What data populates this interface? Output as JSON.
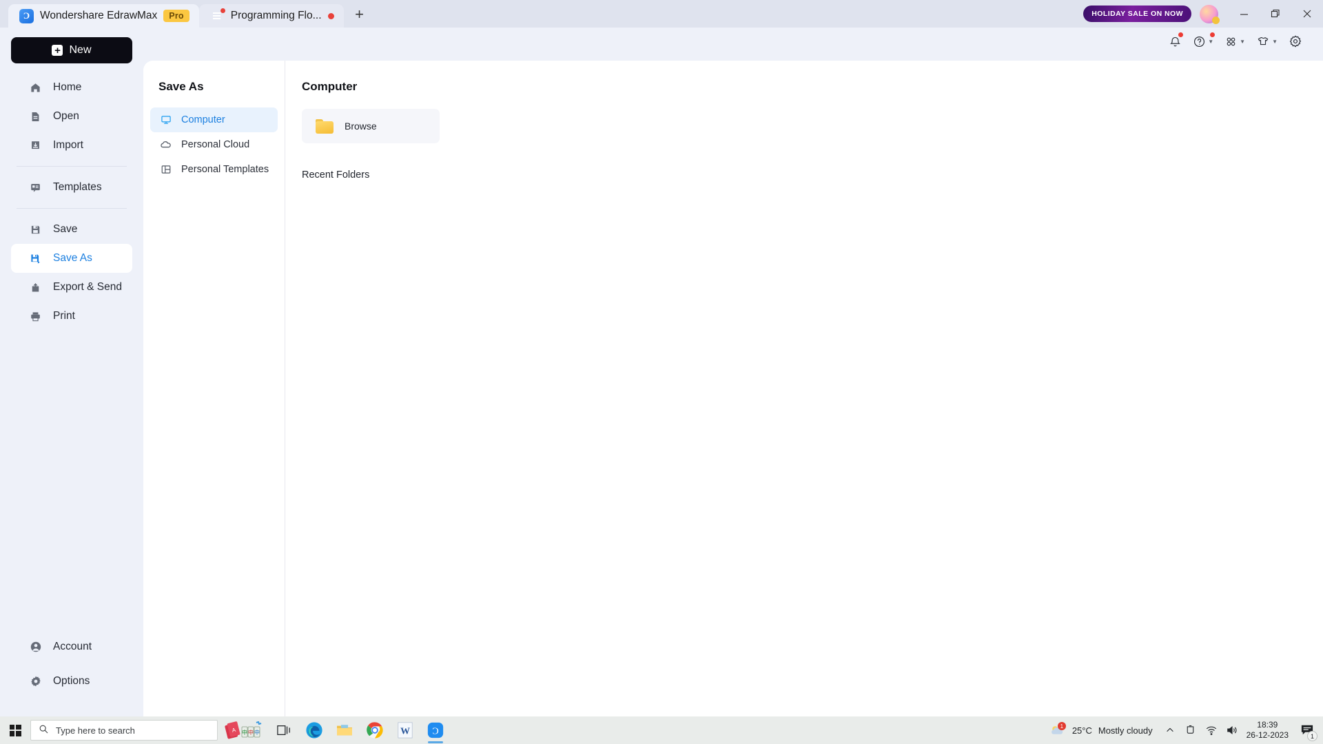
{
  "window": {
    "tabs": [
      {
        "title": "Wondershare EdrawMax",
        "badge": "Pro",
        "icon": "edraw-logo-icon",
        "active": true
      },
      {
        "title": "Programming Flo...",
        "icon": "document-icon",
        "modified_dot": true,
        "active": false
      }
    ],
    "new_tab_label": "+",
    "promo_badge": "HOLIDAY SALE ON NOW",
    "controls": {
      "minimize": "minimize-icon",
      "restore": "restore-icon",
      "close": "close-icon"
    }
  },
  "toolbar": {
    "items": [
      {
        "name": "notification-bell-icon",
        "has_dot": true,
        "has_chevron": false
      },
      {
        "name": "help-icon",
        "has_dot": true,
        "has_chevron": true
      },
      {
        "name": "apps-grid-icon",
        "has_dot": false,
        "has_chevron": true
      },
      {
        "name": "theme-shirt-icon",
        "has_dot": false,
        "has_chevron": true
      },
      {
        "name": "settings-gear-icon",
        "has_dot": false,
        "has_chevron": false
      }
    ]
  },
  "sidebar": {
    "new_button": "New",
    "items": [
      {
        "label": "Home",
        "icon": "home-icon",
        "active": false
      },
      {
        "label": "Open",
        "icon": "folder-open-icon",
        "active": false
      },
      {
        "label": "Import",
        "icon": "import-icon",
        "active": false
      },
      {
        "label": "Templates",
        "icon": "templates-icon",
        "active": false
      },
      {
        "label": "Save",
        "icon": "save-icon",
        "active": false
      },
      {
        "label": "Save As",
        "icon": "save-as-icon",
        "active": true
      },
      {
        "label": "Export & Send",
        "icon": "export-icon",
        "active": false
      },
      {
        "label": "Print",
        "icon": "print-icon",
        "active": false
      }
    ],
    "bottom_items": [
      {
        "label": "Account",
        "icon": "account-icon"
      },
      {
        "label": "Options",
        "icon": "options-gear-icon"
      }
    ]
  },
  "save_as_panel": {
    "title": "Save As",
    "destinations": [
      {
        "label": "Computer",
        "icon": "monitor-icon",
        "active": true
      },
      {
        "label": "Personal Cloud",
        "icon": "cloud-icon",
        "active": false
      },
      {
        "label": "Personal Templates",
        "icon": "layout-icon",
        "active": false
      }
    ]
  },
  "computer_panel": {
    "title": "Computer",
    "browse": {
      "label": "Browse",
      "icon": "folder-icon"
    },
    "recent_folders_label": "Recent Folders",
    "recent_folders": []
  },
  "taskbar": {
    "start": "windows-start-icon",
    "search_placeholder": "Type here to search",
    "icons": [
      "mahjong-game-icon",
      "task-view-icon",
      "microsoft-edge-icon",
      "file-explorer-icon",
      "google-chrome-icon",
      "microsoft-word-icon",
      "edrawmax-icon"
    ],
    "tray": {
      "weather_temp": "25°C",
      "weather_desc": "Mostly cloudy",
      "weather_badge": "1",
      "overflow": "show-hidden-icons-chevron",
      "icons": [
        "onedrive-icon",
        "wifi-icon",
        "volume-icon"
      ],
      "time": "18:39",
      "date": "26-12-2023",
      "notification_count": "1"
    }
  },
  "colors": {
    "accent": "#1b7fe0",
    "sidebar_bg": "#eef1f9",
    "panel_bg": "#ffffff",
    "new_button_bg": "#0c0c14",
    "pro_badge_bg": "#fbc741",
    "alert_dot": "#e8413a",
    "taskbar_bg": "#e9ecea"
  }
}
